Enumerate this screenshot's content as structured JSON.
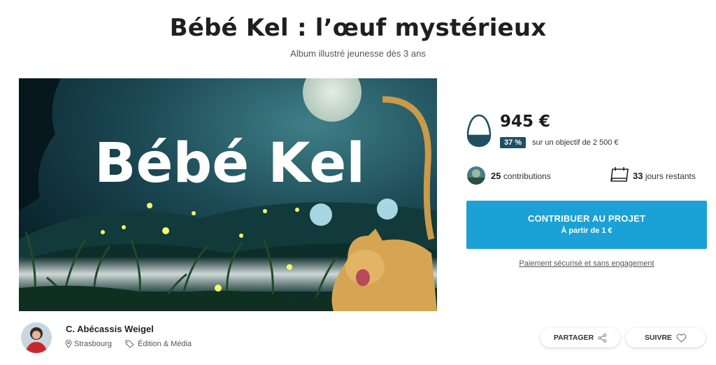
{
  "project": {
    "title": "Bébé Kel : l’œuf mystérieux",
    "subtitle": "Album illustré jeunesse dès 3 ans"
  },
  "hero": {
    "logo_text": "Bébé Kel"
  },
  "funding": {
    "amount": "945 €",
    "percent": "37 %",
    "goal_text": "sur un objectif de 2 500 €",
    "progress_fraction": 0.37,
    "contributions_count": "25",
    "contributions_label": "contributions",
    "days_count": "33",
    "days_label": "jours restants"
  },
  "cta": {
    "label": "CONTRIBUER AU PROJET",
    "sublabel": "À partir de 1 €",
    "secure_text": "Paiement sécurisé et sans engagement"
  },
  "author": {
    "name": "C. Abécassis Weigel",
    "location": "Strasbourg",
    "category": "Édition & Média"
  },
  "actions": {
    "share_label": "PARTAGER",
    "follow_label": "SUIVRE"
  },
  "colors": {
    "cta": "#1ba1d6",
    "badge": "#1f4f63",
    "egg_fill": "#1f4f63"
  },
  "icons": [
    "egg-icon",
    "calendar-icon",
    "location-pin-icon",
    "tag-icon",
    "share-icon",
    "heart-icon"
  ]
}
